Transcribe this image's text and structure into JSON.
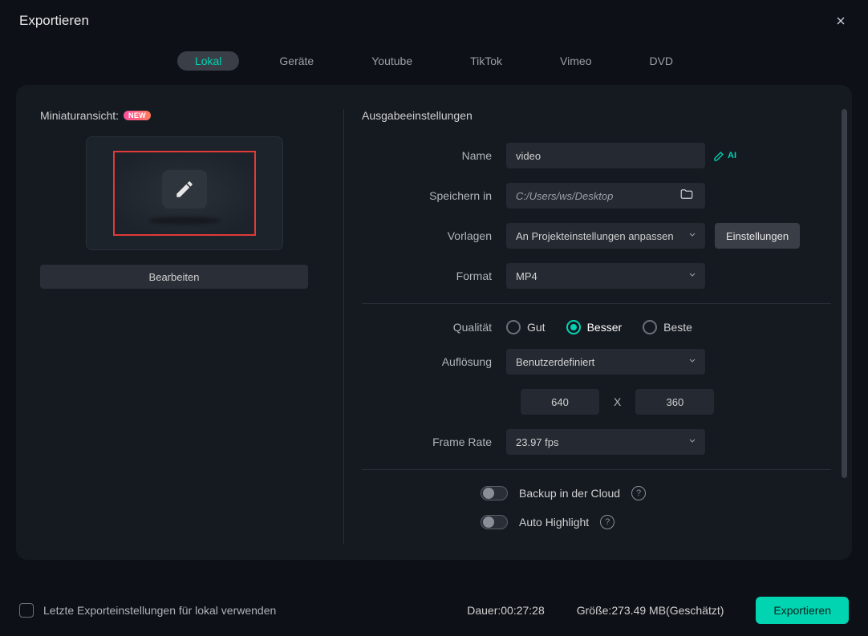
{
  "window": {
    "title": "Exportieren"
  },
  "tabs": [
    {
      "label": "Lokal",
      "active": true
    },
    {
      "label": "Geräte",
      "active": false
    },
    {
      "label": "Youtube",
      "active": false
    },
    {
      "label": "TikTok",
      "active": false
    },
    {
      "label": "Vimeo",
      "active": false
    },
    {
      "label": "DVD",
      "active": false
    }
  ],
  "thumbnail": {
    "header": "Miniaturansicht:",
    "new_badge": "NEW",
    "edit_button": "Bearbeiten"
  },
  "settings": {
    "section_title": "Ausgabeeinstellungen",
    "name": {
      "label": "Name",
      "value": "video",
      "ai_suffix": "AI"
    },
    "save_to": {
      "label": "Speichern in",
      "value": "C:/Users/ws/Desktop"
    },
    "templates": {
      "label": "Vorlagen",
      "value": "An Projekteinstellungen anpassen",
      "settings_btn": "Einstellungen"
    },
    "format": {
      "label": "Format",
      "value": "MP4"
    },
    "quality": {
      "label": "Qualität",
      "options": [
        {
          "label": "Gut",
          "selected": false
        },
        {
          "label": "Besser",
          "selected": true
        },
        {
          "label": "Beste",
          "selected": false
        }
      ]
    },
    "resolution": {
      "label": "Auflösung",
      "value": "Benutzerdefiniert",
      "width": "640",
      "height": "360",
      "separator": "X"
    },
    "framerate": {
      "label": "Frame Rate",
      "value": "23.97 fps"
    },
    "backup": {
      "label": "Backup in der Cloud",
      "enabled": false
    },
    "highlight": {
      "label": "Auto Highlight",
      "enabled": false
    }
  },
  "footer": {
    "checkbox_label": "Letzte Exporteinstellungen für lokal verwenden",
    "duration_label": "Dauer:",
    "duration_value": "00:27:28",
    "size_label": "Größe:",
    "size_value": "273.49 MB",
    "size_suffix": "(Geschätzt)",
    "export_button": "Exportieren"
  }
}
